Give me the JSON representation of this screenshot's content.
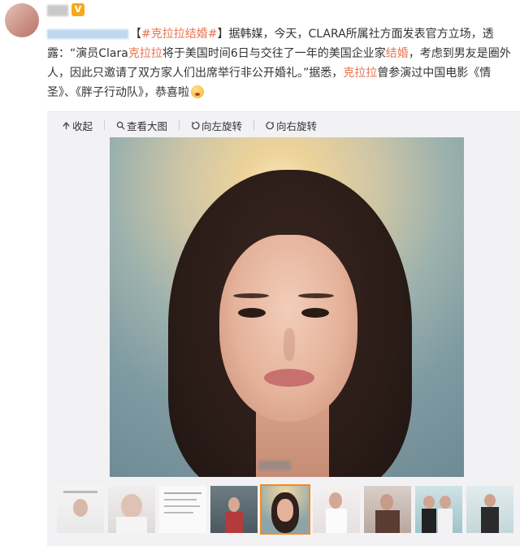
{
  "post": {
    "tag": "#克拉拉结婚#",
    "segments": [
      "【",
      "#克拉拉结婚#",
      "】据韩媒，今天，CLARA所属社方面发表官方立场，透露：“演员Clara",
      "克拉拉",
      "将于美国时间6日与交往了一年的美国企业家",
      "结婚",
      "，考虑到男友是圈外人，因此只邀请了双方家人们出席举行非公开婚礼。”据悉，",
      "克拉拉",
      "曾参演过中国电影《情圣》、《胖子行动队》，恭喜啦"
    ]
  },
  "toolbar": {
    "collapse": "收起",
    "view_large": "查看大图",
    "rotate_left": "向左旋转",
    "rotate_right": "向右旋转"
  },
  "colors": {
    "highlight": "#eb7350",
    "selected_thumb_border": "#f28c28",
    "vip_badge": "#f7a81b"
  },
  "thumbnails": [
    {
      "selected": false
    },
    {
      "selected": false
    },
    {
      "selected": false
    },
    {
      "selected": false
    },
    {
      "selected": true
    },
    {
      "selected": false
    },
    {
      "selected": false
    },
    {
      "selected": false
    },
    {
      "selected": false
    }
  ]
}
